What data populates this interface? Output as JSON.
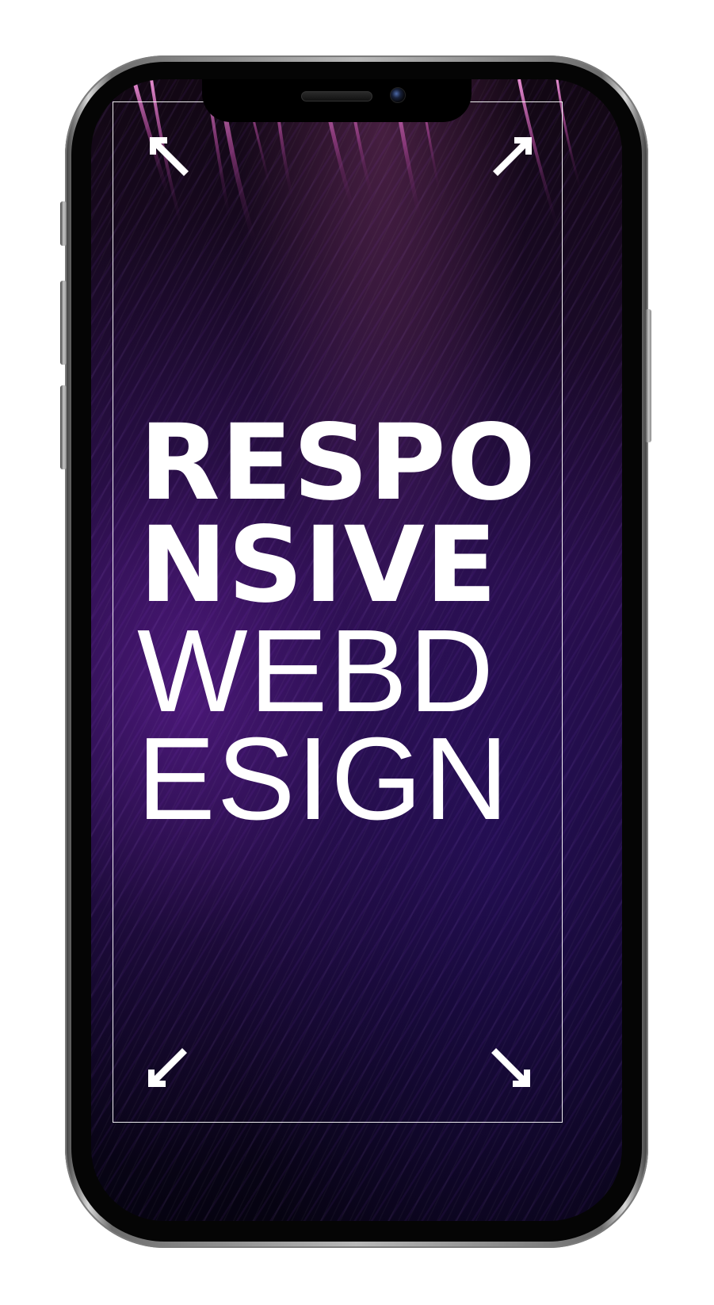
{
  "poster": {
    "headline_lines": {
      "line1": "RESPO",
      "line2": "NSIVE",
      "line3": "WEBD",
      "line4": "ESIGN"
    },
    "icons": {
      "arrow_top_left": "arrow-up-left-icon",
      "arrow_top_right": "arrow-up-right-icon",
      "arrow_bottom_left": "arrow-down-left-icon",
      "arrow_bottom_right": "arrow-down-right-icon"
    },
    "colors": {
      "text": "#ffffff",
      "background_primary": "#1a0a28",
      "accent_purple": "#6e22aa",
      "accent_pink": "#c85aaa"
    }
  },
  "device": {
    "type": "smartphone",
    "frame_color": "#b9b9b9"
  }
}
